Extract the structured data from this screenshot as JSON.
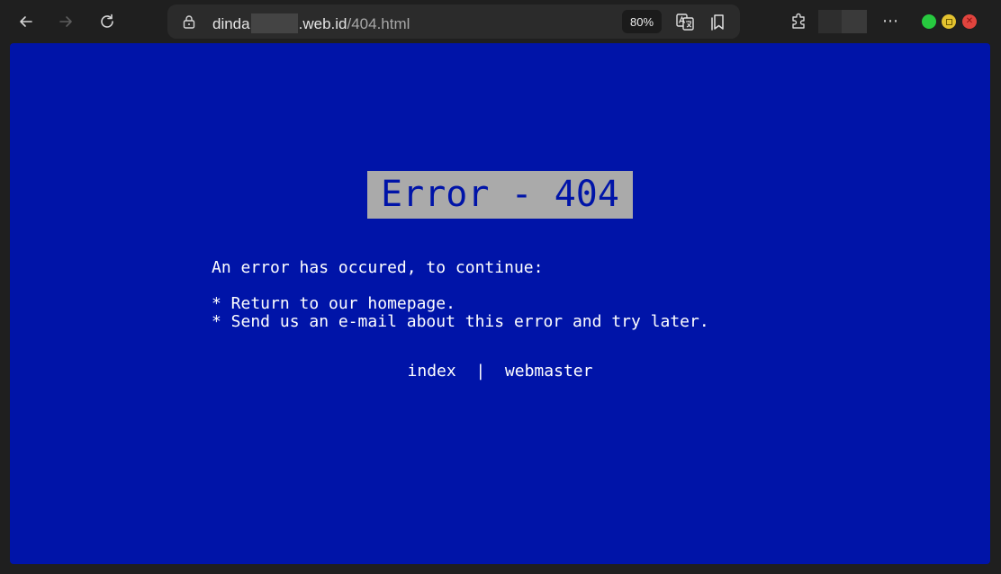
{
  "browser": {
    "url_host_prefix": "dinda",
    "url_host_suffix": ".web.id",
    "url_path": "/404.html",
    "zoom": "80%"
  },
  "icons": {
    "back": "back-arrow-icon",
    "forward": "forward-arrow-icon",
    "refresh": "refresh-icon",
    "lock": "lock-icon",
    "translate": "translate-icon",
    "favorites": "favorites-icon",
    "extensions": "extensions-icon",
    "more": "more-icon",
    "maximize": "maximize-icon",
    "close": "close-icon",
    "minimize": "minimize-icon"
  },
  "colors": {
    "page_background": "#0014a8",
    "title_background": "#aaaaaa",
    "text": "#ffffff",
    "chrome": "#1f1f1f"
  },
  "page": {
    "title": "Error - 404",
    "intro": "An error has occured, to continue:",
    "items": [
      "* Return to our homepage.",
      "* Send us an e-mail about this error and try later."
    ],
    "links": {
      "index": "index",
      "separator": "|",
      "webmaster": "webmaster"
    }
  }
}
